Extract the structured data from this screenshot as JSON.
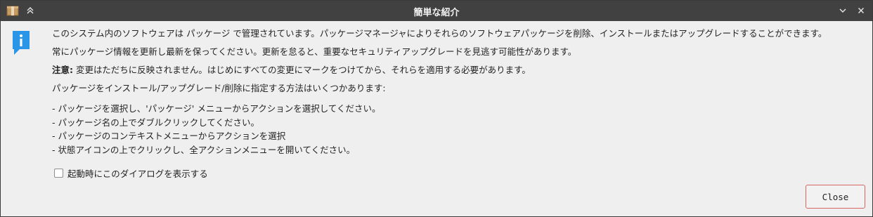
{
  "window": {
    "title": "簡単な紹介"
  },
  "content": {
    "para1": "このシステム内のソフトウェアは パッケージ で管理されています。パッケージマネージャによりそれらのソフトウェアパッケージを削除、インストールまたはアップグレードすることができます。",
    "para2": "常にパッケージ情報を更新し最新を保ってください。更新を怠ると、重要なセキュリティアップグレードを見逃す可能性があります。",
    "note_label": "注意:",
    "note_text": " 変更はただちに反映されません。はじめにすべての変更にマークをつけてから、それらを適用する必要があります。",
    "para4": "パッケージをインストール/アップグレード/削除に指定する方法はいくつかあります:",
    "methods": [
      " -  パッケージを選択し、'パッケージ' メニューからアクションを選択してください。",
      " -  パッケージ名の上でダブルクリックしてください。",
      " -  パッケージのコンテキストメニューからアクションを選択",
      " -  状態アイコンの上でクリックし、全アクションメニューを開いてください。"
    ]
  },
  "checkbox": {
    "label": "起動時にこのダイアログを表示する",
    "checked": false
  },
  "buttons": {
    "close": "Close"
  },
  "icons": {
    "app": "package-icon",
    "shade": "shade-up-icon",
    "info": "info-icon",
    "minimize": "chevron-down-icon",
    "close": "close-icon"
  },
  "colors": {
    "titlebar": "#414141",
    "info_blue": "#2b95e8",
    "close_border": "#d56666"
  }
}
